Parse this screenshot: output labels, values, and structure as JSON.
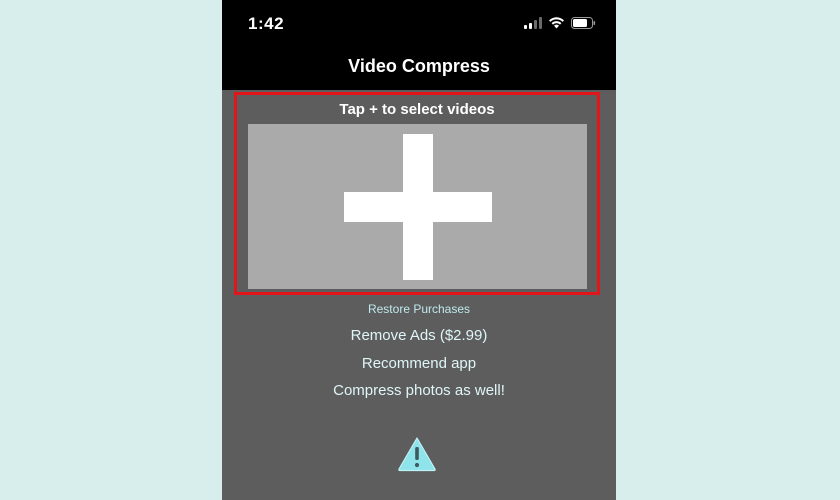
{
  "status_bar": {
    "time": "1:42"
  },
  "nav": {
    "title": "Video Compress"
  },
  "select": {
    "hint": "Tap + to select videos"
  },
  "links": {
    "restore": "Restore Purchases",
    "remove_ads": "Remove Ads ($2.99)",
    "recommend": "Recommend app",
    "compress_photos": "Compress photos as well!"
  },
  "colors": {
    "highlight_border": "#e0161b",
    "warning_fill": "#8fe3ea",
    "link_text": "#dff5f6"
  },
  "icons": {
    "add": "plus-icon",
    "warning": "warning-icon",
    "wifi": "wifi-icon",
    "battery": "battery-icon",
    "signal": "signal-icon"
  }
}
